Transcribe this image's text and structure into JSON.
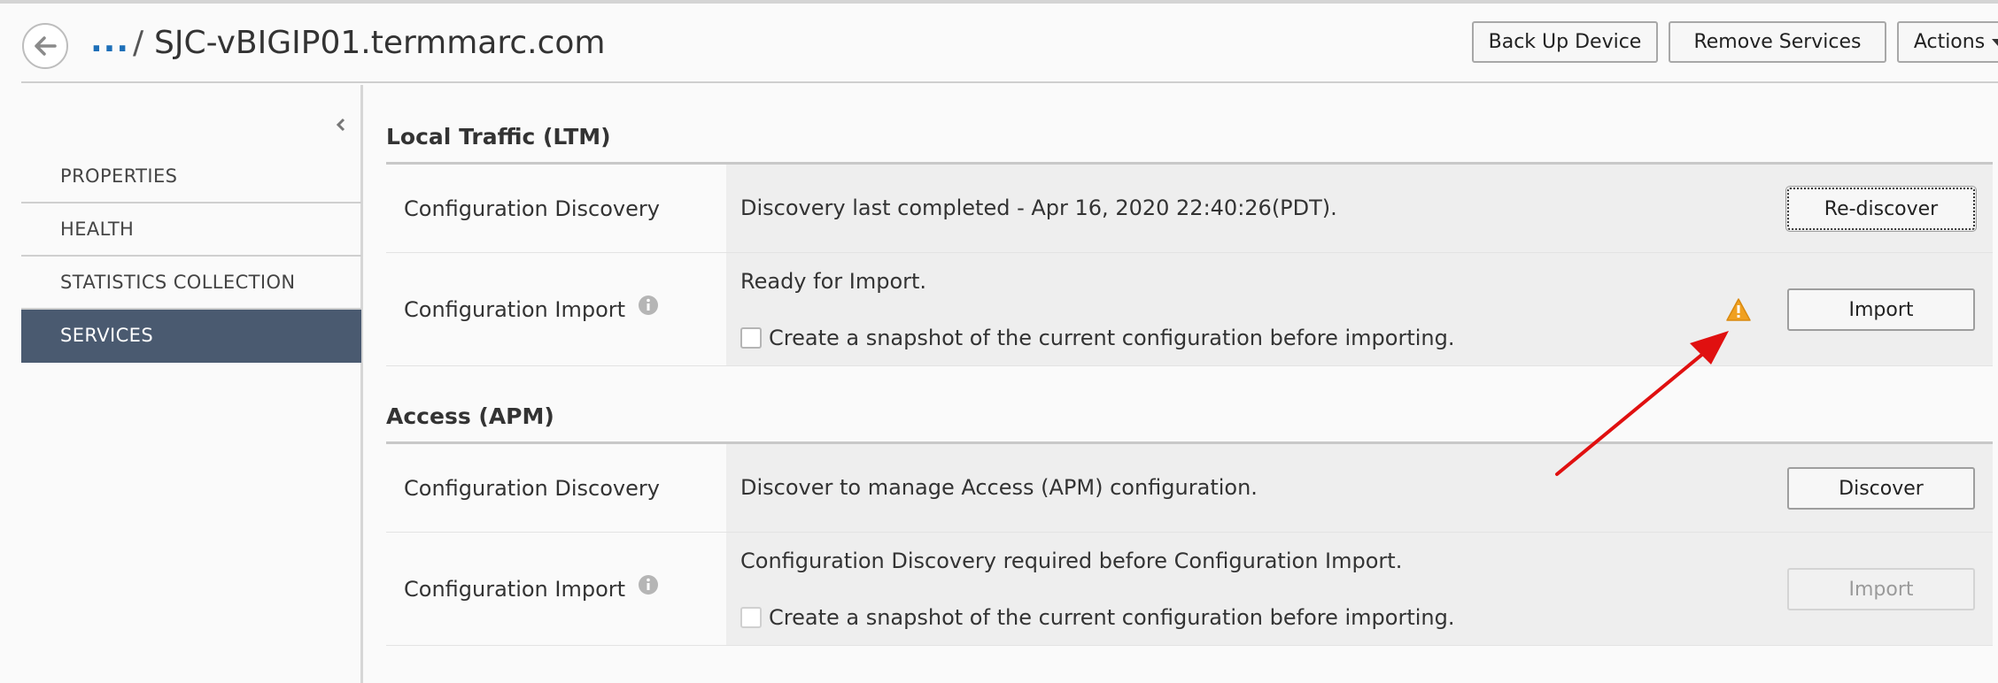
{
  "header": {
    "breadcrumb_more": "...",
    "breadcrumb_separator": "/",
    "title": "SJC-vBIGIP01.termmarc.com",
    "buttons": {
      "back_up": "Back Up Device",
      "remove_services": "Remove Services",
      "actions": "Actions"
    }
  },
  "sidebar": {
    "items": [
      {
        "label": "PROPERTIES",
        "active": false
      },
      {
        "label": "HEALTH",
        "active": false
      },
      {
        "label": "STATISTICS COLLECTION",
        "active": false
      },
      {
        "label": "SERVICES",
        "active": true
      }
    ]
  },
  "sections": [
    {
      "title": "Local Traffic (LTM)",
      "discovery": {
        "label": "Configuration Discovery",
        "status": "Discovery last completed - Apr 16, 2020 22:40:26(PDT).",
        "button": "Re-discover"
      },
      "import": {
        "label": "Configuration Import",
        "status": "Ready for Import.",
        "snapshot_label": "Create a snapshot of the current configuration before importing.",
        "button": "Import"
      }
    },
    {
      "title": "Access (APM)",
      "discovery": {
        "label": "Configuration Discovery",
        "status": "Discover to manage Access (APM) configuration.",
        "button": "Discover"
      },
      "import": {
        "label": "Configuration Import",
        "status": "Configuration Discovery required before Configuration Import.",
        "snapshot_label": "Create a snapshot of the current configuration before importing.",
        "button": "Import"
      }
    }
  ],
  "colors": {
    "accent_link": "#1d6fb8",
    "sidebar_active": "#4a5a70",
    "warning": "#f0a020",
    "annotation_arrow": "#e01010"
  },
  "icons": {
    "back": "left-arrow-circle",
    "collapse": "chevron-left",
    "info": "info-circle",
    "warning": "warning-triangle"
  }
}
